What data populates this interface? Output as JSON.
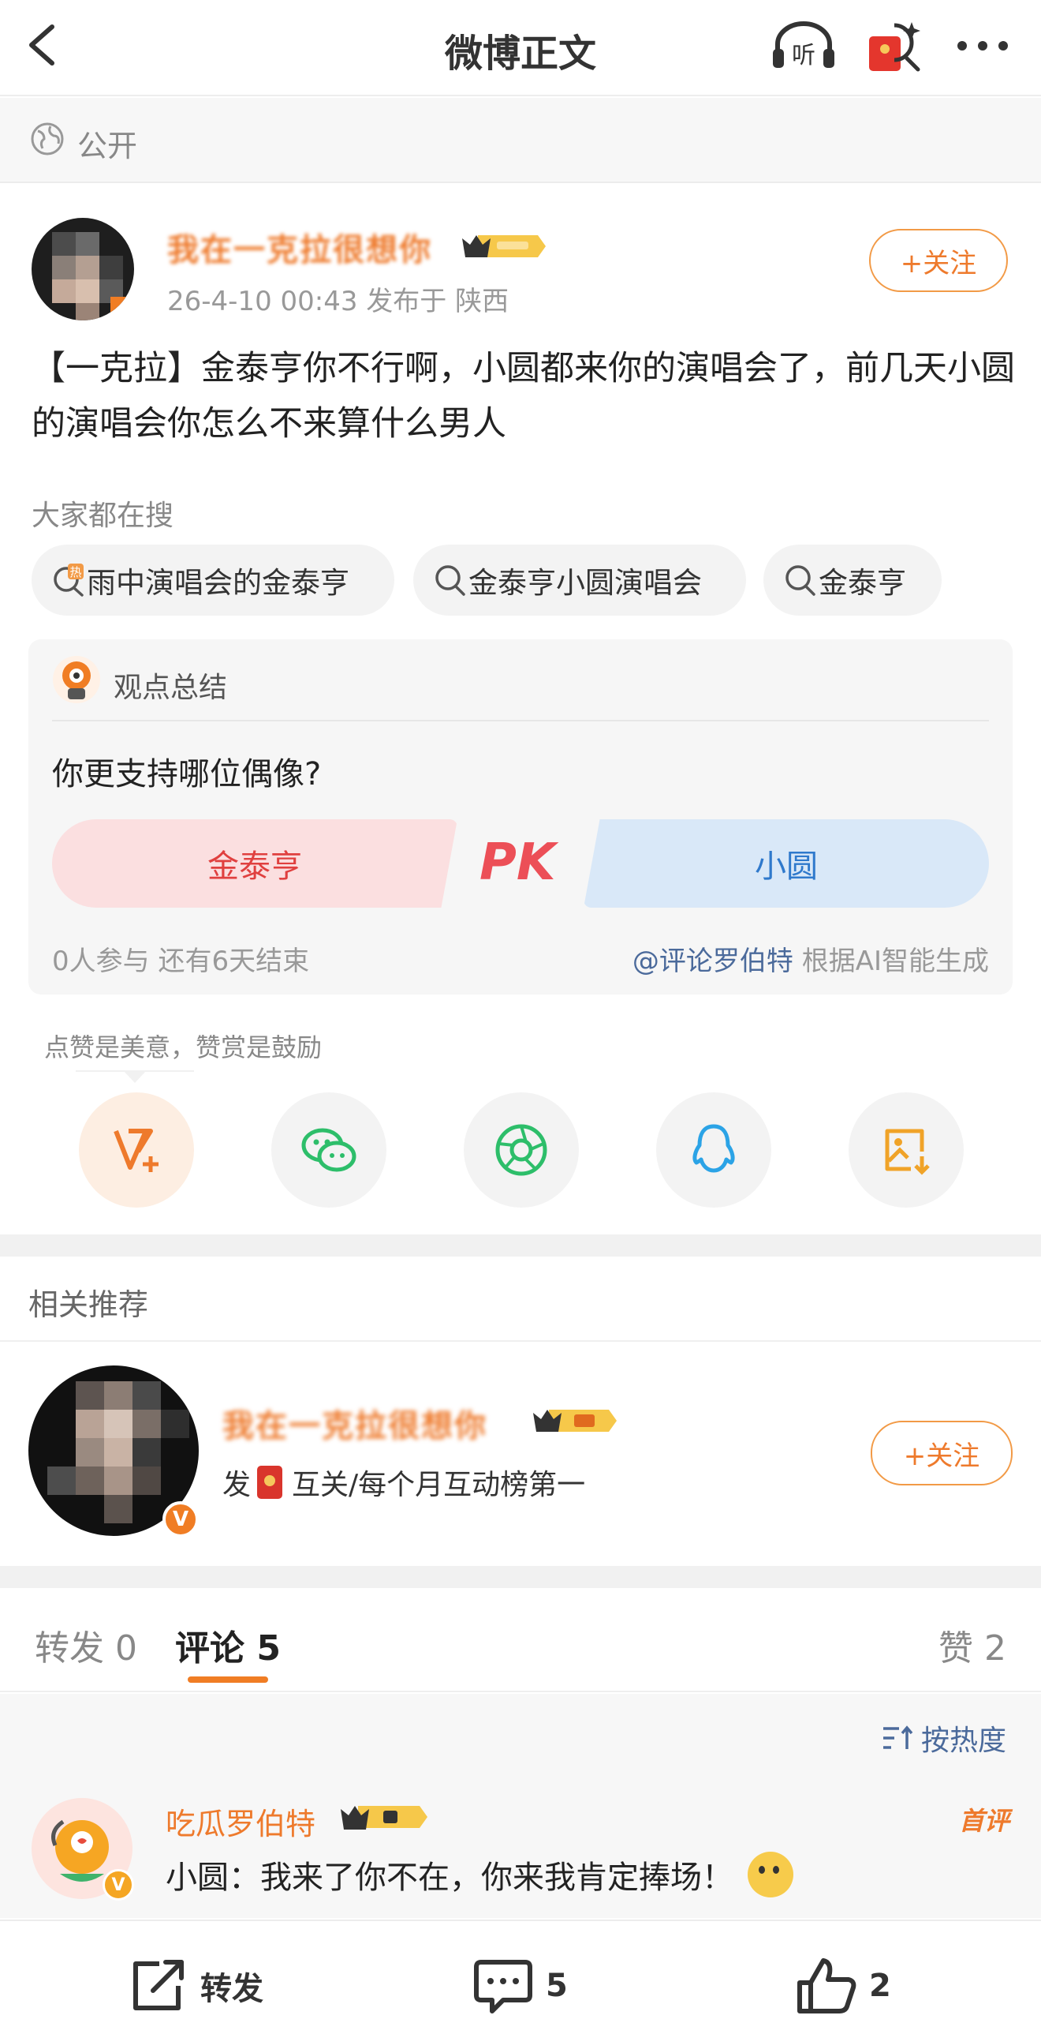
{
  "topbar": {
    "title": "微博正文",
    "icons": [
      "back-icon",
      "listen-icon",
      "red-packet-icon",
      "more-icon"
    ],
    "listen_label": "听"
  },
  "visibility": {
    "label": "公开"
  },
  "post": {
    "author": "我在一克拉很想你",
    "meta": "26-4-10 00:43  发布于 陕西",
    "follow_label": "+关注",
    "text": "【一克拉】金泰亨你不行啊，小圆都来你的演唱会了，前几天小圆的演唱会你怎么不来算什么男人"
  },
  "search": {
    "caption": "大家都在搜",
    "chips": [
      "雨中演唱会的金泰亨",
      "金泰亨小圆演唱会",
      "金泰亨"
    ],
    "hot_label": "热"
  },
  "summary": {
    "heading": "观点总结",
    "question": "你更支持哪位偶像?",
    "option_left": "金泰亨",
    "option_right": "小圆",
    "pk": "PK",
    "participants": "0人参与   还有6天结束",
    "source_at": "@评论罗伯特",
    "source_note": " 根据AI智能生成"
  },
  "reward": {
    "caption": "点赞是美意，赞赏是鼓励",
    "share_icons": [
      "reward-icon",
      "wechat-icon",
      "moments-icon",
      "qq-icon",
      "save-image-icon"
    ]
  },
  "related": {
    "title": "相关推荐",
    "user": "我在一克拉很想你",
    "desc_before": "发",
    "desc_after": "互关/每个月互动榜第一",
    "follow_label": "+关注"
  },
  "tabs": {
    "repost": "转发 0",
    "comments": "评论 5",
    "likes": "赞 2"
  },
  "comments": {
    "sort_label": "按热度",
    "items": [
      {
        "name": "吃瓜罗伯特",
        "tag": "首评",
        "text": "小圆：我来了你不在，你来我肯定捧场！"
      }
    ]
  },
  "bottombar": {
    "repost": "转发",
    "comment_count": "5",
    "like_count": "2"
  },
  "colors": {
    "accent": "#ee7a2c",
    "pk_red": "#e0403f",
    "pk_blue": "#2f79cc",
    "link": "#4b6a9b"
  }
}
